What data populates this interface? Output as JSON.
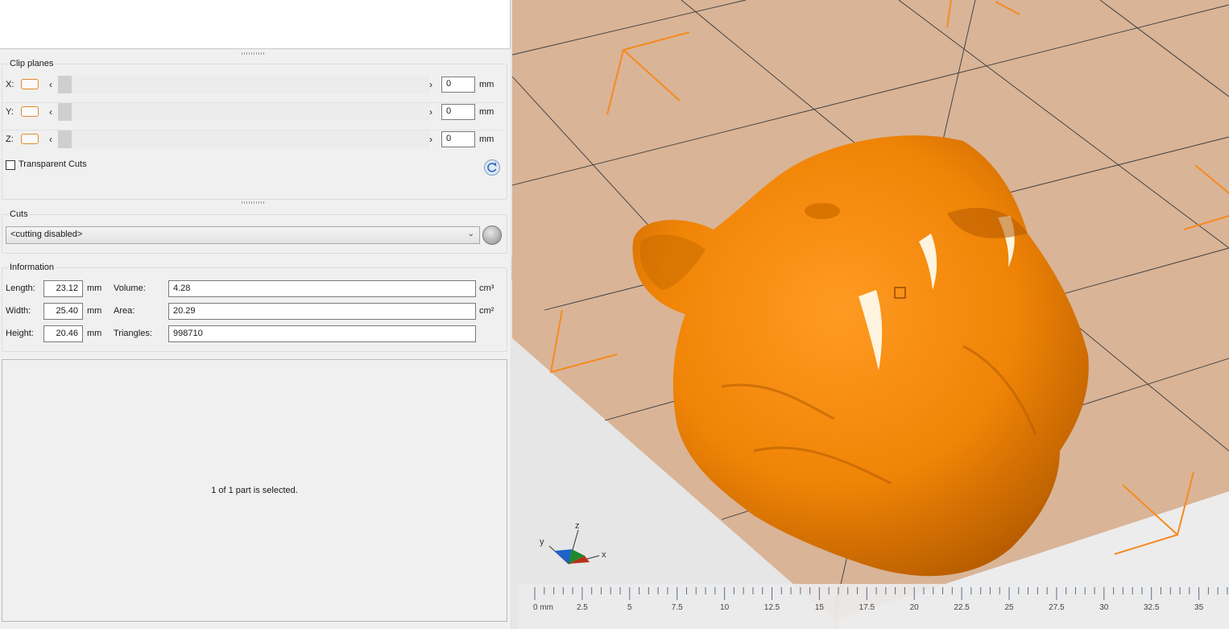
{
  "clip_planes": {
    "title": "Clip planes",
    "axes": [
      {
        "label": "X:",
        "value": "0",
        "unit": "mm"
      },
      {
        "label": "Y:",
        "value": "0",
        "unit": "mm"
      },
      {
        "label": "Z:",
        "value": "0",
        "unit": "mm"
      }
    ],
    "transparent_cuts_label": "Transparent Cuts",
    "transparent_cuts_checked": false
  },
  "cuts": {
    "title": "Cuts",
    "selected": "<cutting disabled>"
  },
  "information": {
    "title": "Information",
    "length": {
      "label": "Length:",
      "value": "23.12",
      "unit": "mm"
    },
    "width": {
      "label": "Width:",
      "value": "25.40",
      "unit": "mm"
    },
    "height": {
      "label": "Height:",
      "value": "20.46",
      "unit": "mm"
    },
    "volume": {
      "label": "Volume:",
      "value": "4.28",
      "unit": "cm³"
    },
    "area": {
      "label": "Area:",
      "value": "20.29",
      "unit": "cm²"
    },
    "triangles": {
      "label": "Triangles:",
      "value": "998710"
    }
  },
  "status": {
    "selection_text": "1 of 1 part is selected."
  },
  "viewport": {
    "axis_labels": {
      "x": "x",
      "y": "y",
      "z": "z"
    },
    "ruler_labels": [
      "0 mm",
      "2.5",
      "5",
      "7.5",
      "10",
      "12.5",
      "15",
      "17.5",
      "20",
      "22.5",
      "25",
      "27.5",
      "30",
      "32.5",
      "35"
    ],
    "colors": {
      "model": "#f7890f",
      "bed": "#d9b497",
      "grid": "#3a3a3a",
      "corner_marks": "#f58a1f"
    }
  }
}
